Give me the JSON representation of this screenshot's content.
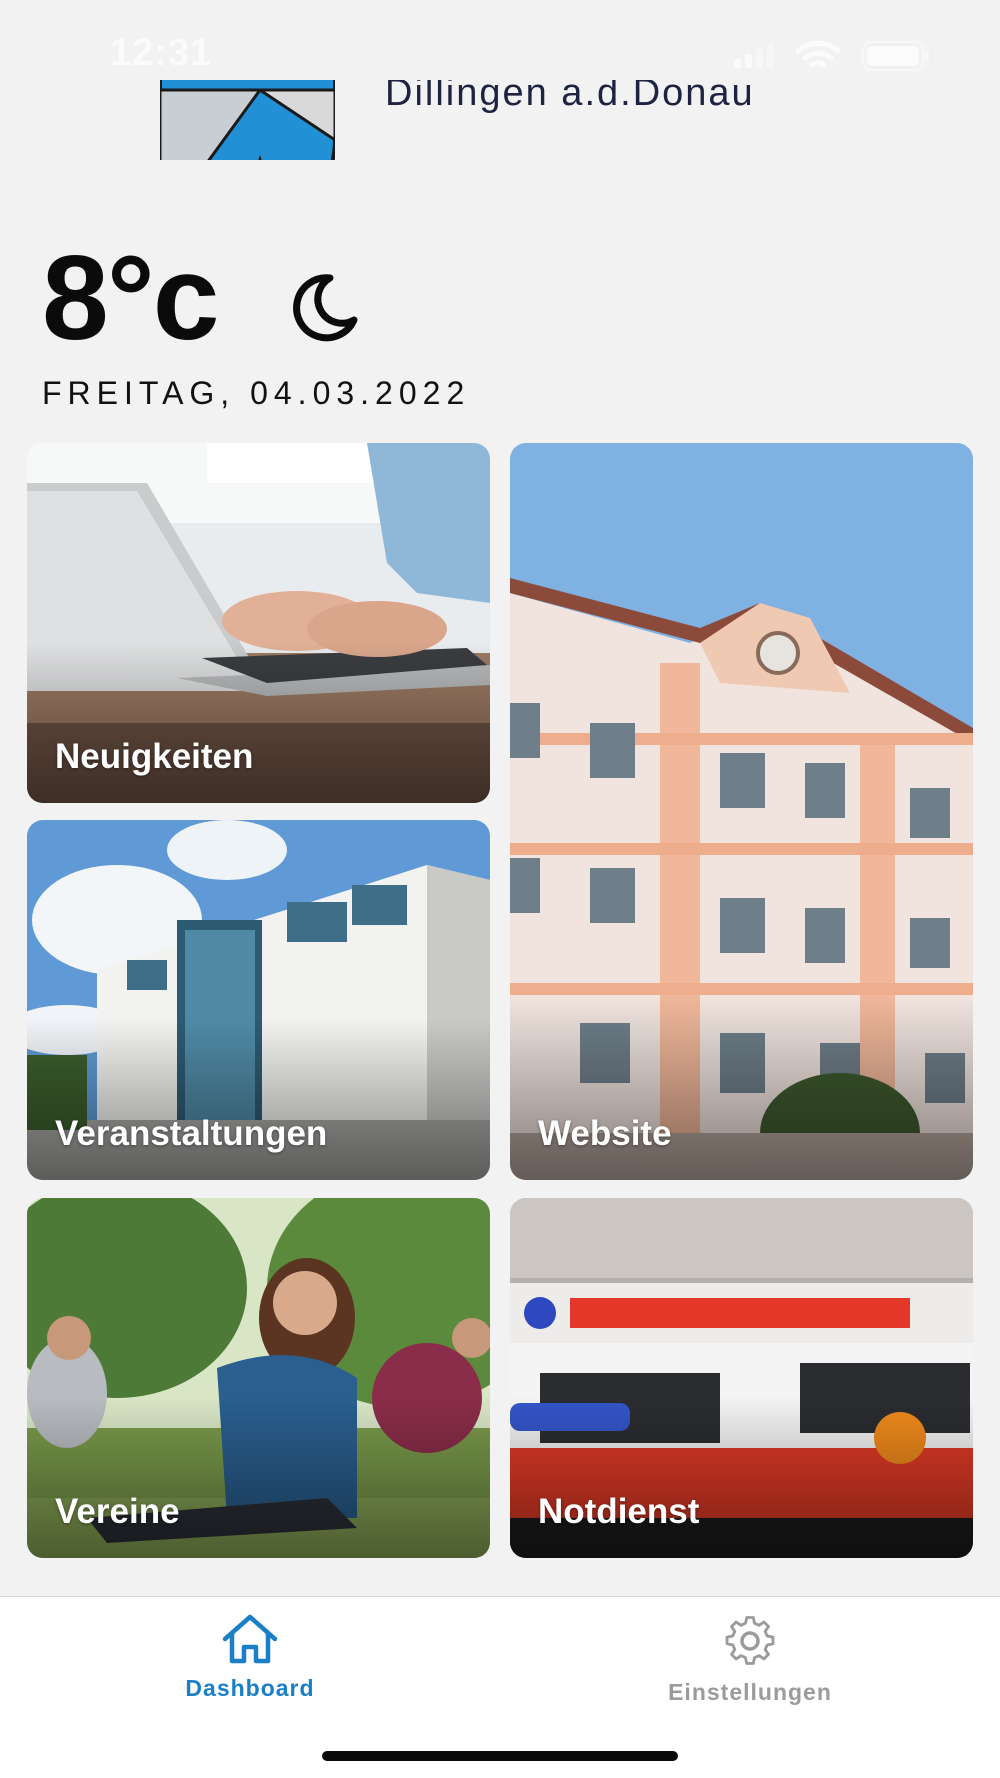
{
  "status_bar": {
    "time": "12:31"
  },
  "header": {
    "city": "Dillingen a.d.Donau"
  },
  "weather": {
    "temperature": "8°c",
    "condition_icon": "moon-icon",
    "date": "FREITAG, 04.03.2022"
  },
  "tiles": {
    "news": "Neuigkeiten",
    "events": "Veranstaltungen",
    "website": "Website",
    "clubs": "Vereine",
    "emergency": "Notdienst"
  },
  "tab_bar": {
    "dashboard": "Dashboard",
    "settings": "Einstellungen",
    "active_color": "#1b7fc7",
    "inactive_color": "#9b9b9b"
  }
}
